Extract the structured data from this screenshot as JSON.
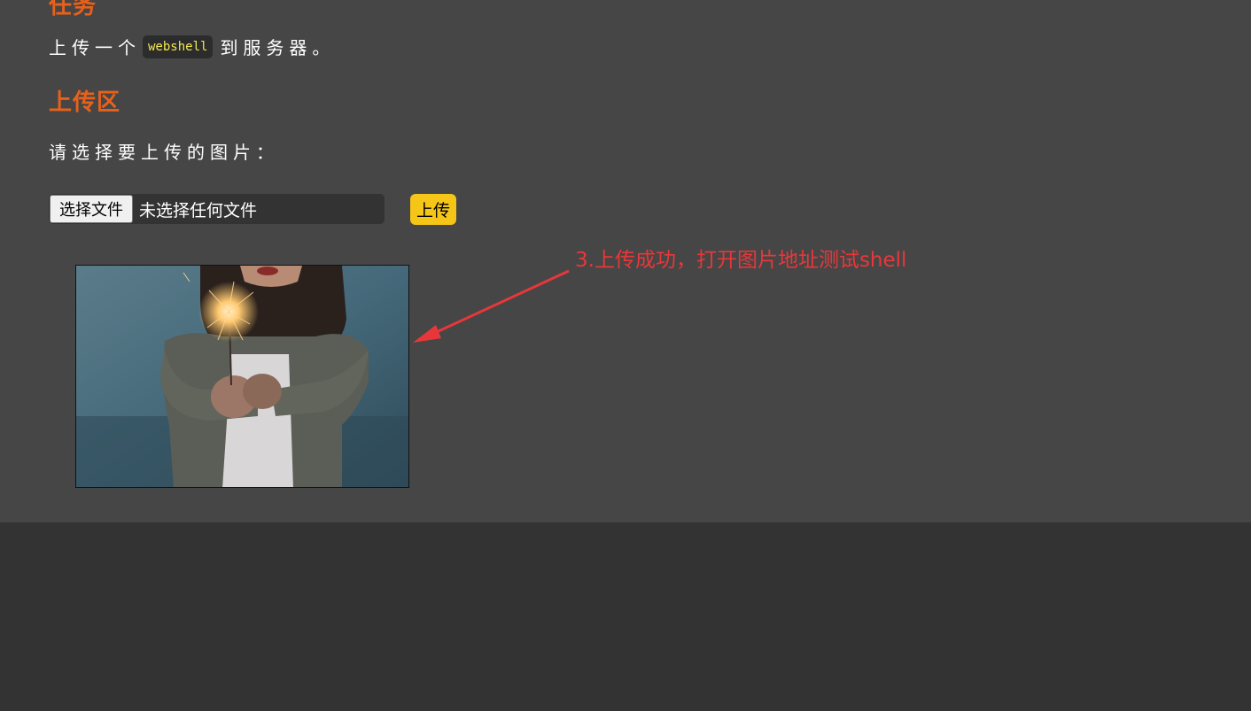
{
  "task": {
    "heading": "任务",
    "text_before": "上传一个",
    "code": "webshell",
    "text_after": "到服务器。"
  },
  "upload_area": {
    "heading": "上传区",
    "prompt": "请选择要上传的图片："
  },
  "file_input": {
    "button_label": "选择文件",
    "status": "未选择任何文件"
  },
  "upload_button": {
    "label": "上传"
  },
  "annotation": {
    "text": "3.上传成功，打开图片地址测试shell",
    "color": "#e8373a"
  },
  "colors": {
    "panel_background": "#464646",
    "page_background": "#333333",
    "heading": "#e8611a",
    "upload_button": "#f5c518",
    "code_text": "#f2e94e"
  },
  "uploaded_image": {
    "description_icon": "photo-icon"
  }
}
